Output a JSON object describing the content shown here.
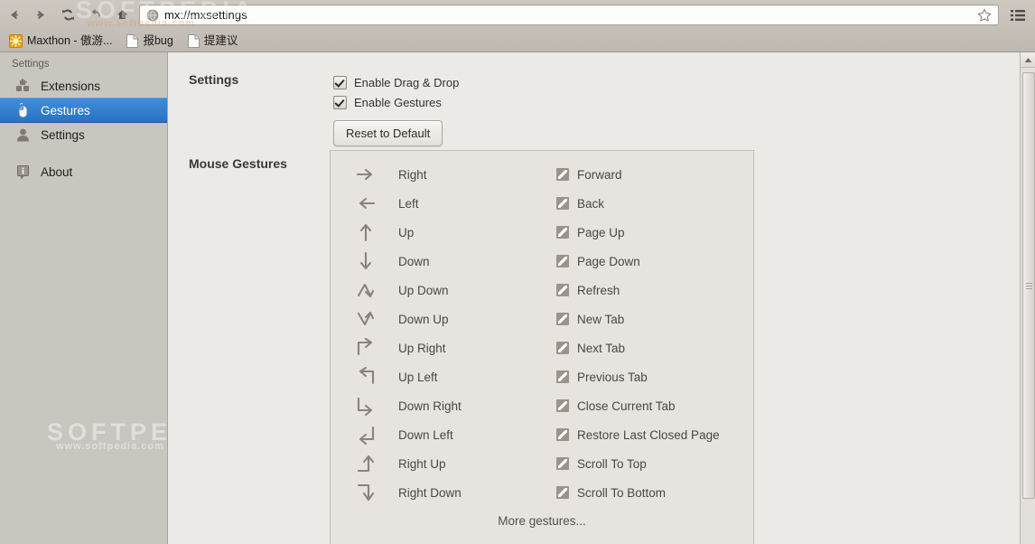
{
  "browser": {
    "nav_buttons": [
      {
        "name": "back",
        "label": "Back"
      },
      {
        "name": "forward",
        "label": "Forward"
      },
      {
        "name": "reload",
        "label": "Reload"
      },
      {
        "name": "undo",
        "label": "Undo"
      },
      {
        "name": "home",
        "label": "Home"
      }
    ],
    "address_bar": {
      "url": "mx://mxsettings",
      "placeholder": "mx://mxsettings",
      "favicon": "globe-icon",
      "bookmark_icon": "star-icon"
    },
    "menu_icon": "hamburger-menu-icon",
    "bookmarks": [
      {
        "label": "Maxthon - 傲游...",
        "icon": "maxthon-sun-icon"
      },
      {
        "label": "报bug",
        "icon": "page-icon"
      },
      {
        "label": "提建议",
        "icon": "page-icon"
      }
    ],
    "watermark": {
      "line1": "SOFTPEDIA",
      "line2": "www.softpedia.com"
    }
  },
  "sidebar": {
    "title": "Settings",
    "items": [
      {
        "label": "Extensions",
        "icon": "extensions-icon",
        "selected": false
      },
      {
        "label": "Gestures",
        "icon": "mouse-icon",
        "selected": true
      },
      {
        "label": "Settings",
        "icon": "user-icon",
        "selected": false
      },
      {
        "label": "About",
        "icon": "info-icon",
        "selected": false
      }
    ],
    "selected_color": "#2a72c4"
  },
  "main": {
    "settings_label": "Settings",
    "mouse_gestures_label": "Mouse Gestures",
    "checkboxes": [
      {
        "label": "Enable Drag & Drop",
        "checked": true
      },
      {
        "label": "Enable Gestures",
        "checked": true
      }
    ],
    "reset_button": "Reset to Default",
    "more_gestures": "More gestures...",
    "gestures": [
      {
        "gesture": "Right",
        "arrow": "arrow-right-icon",
        "action": "Forward"
      },
      {
        "gesture": "Left",
        "arrow": "arrow-left-icon",
        "action": "Back"
      },
      {
        "gesture": "Up",
        "arrow": "arrow-up-icon",
        "action": "Page Up"
      },
      {
        "gesture": "Down",
        "arrow": "arrow-down-icon",
        "action": "Page Down"
      },
      {
        "gesture": "Up Down",
        "arrow": "arrow-up-down-icon",
        "action": "Refresh"
      },
      {
        "gesture": "Down Up",
        "arrow": "arrow-down-up-icon",
        "action": "New Tab"
      },
      {
        "gesture": "Up Right",
        "arrow": "arrow-up-right-icon",
        "action": "Next Tab"
      },
      {
        "gesture": "Up Left",
        "arrow": "arrow-up-left-icon",
        "action": "Previous Tab"
      },
      {
        "gesture": "Down Right",
        "arrow": "arrow-down-right-icon",
        "action": "Close Current Tab"
      },
      {
        "gesture": "Down Left",
        "arrow": "arrow-down-left-icon",
        "action": "Restore Last Closed Page"
      },
      {
        "gesture": "Right Up",
        "arrow": "arrow-right-up-icon",
        "action": "Scroll To Top"
      },
      {
        "gesture": "Right Down",
        "arrow": "arrow-right-down-icon",
        "action": "Scroll To Bottom"
      }
    ]
  },
  "colors": {
    "accent": "#2a72c4",
    "chrome_bg": "#c6c1b8",
    "sidebar_bg": "#c9c5bf",
    "content_bg": "#eceae6",
    "panel_bg": "#e7e4df",
    "text": "#4b4743"
  }
}
